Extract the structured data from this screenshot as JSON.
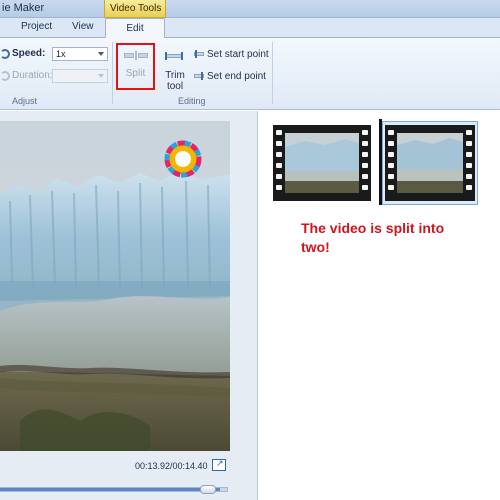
{
  "window": {
    "title": "ie Maker"
  },
  "context_tab": {
    "label": "Video Tools"
  },
  "tabs": {
    "project": "Project",
    "view": "View",
    "edit": "Edit"
  },
  "ribbon": {
    "adjust": {
      "speed_label": "Speed:",
      "speed_value": "1x",
      "duration_label": "Duration:",
      "duration_value": "",
      "group_label": "Adjust"
    },
    "editing": {
      "split_label": "Split",
      "trim_label": "Trim\ntool",
      "set_start_label": "Set start point",
      "set_end_label": "Set end point",
      "group_label": "Editing"
    }
  },
  "preview": {
    "timecode": "00:13.92/00:14.40",
    "fullscreen_icon": "expand-icon",
    "position_fraction": 0.967
  },
  "storyboard": {
    "clips": [
      {
        "name": "clip-1",
        "selected": false
      },
      {
        "name": "clip-2",
        "selected": true
      }
    ],
    "annotation": "The video is split into two!"
  },
  "colors": {
    "annotation": "#d3141c",
    "highlight_box": "#e01414",
    "ribbon_bg": "#dfe9f6",
    "context_tab": "#e8cf55"
  }
}
